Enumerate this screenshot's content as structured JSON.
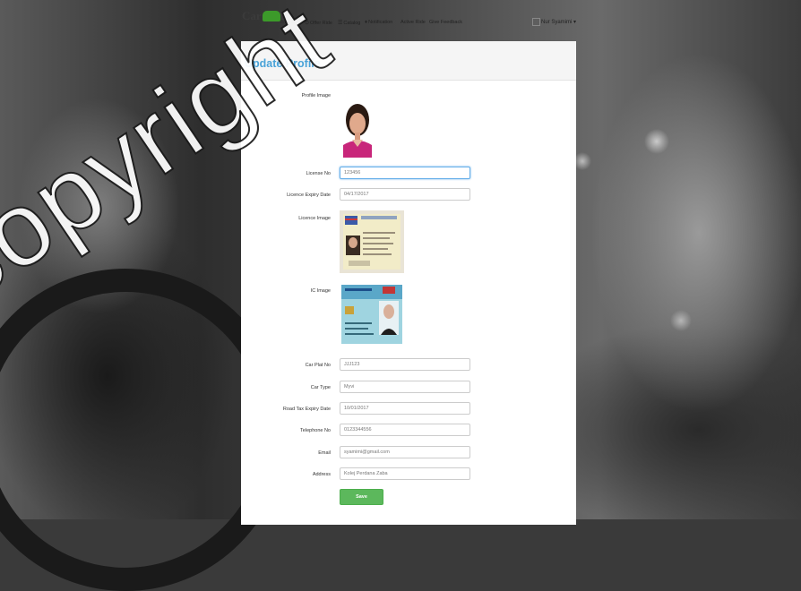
{
  "brand": {
    "logo_text": "Car Pool"
  },
  "nav": {
    "home": "Home",
    "offer_ride": "Offer Ride",
    "catalog": "Catalog",
    "notification": "Notification",
    "active_ride": "Active Ride",
    "feedback": "Give Feedback",
    "user_name": "Nur Syamimi",
    "user_caret": "▾"
  },
  "page": {
    "title": "Update Profile"
  },
  "form": {
    "profile_image_label": "Profile Image",
    "license_no_label": "License No",
    "license_no_value": "123456",
    "license_expiry_label": "Licence Expiry Date",
    "license_expiry_value": "04/17/2017",
    "license_image_label": "Licence Image",
    "ic_image_label": "IC Image",
    "car_plat_label": "Car Plat No",
    "car_plat_value": "JJJ123",
    "car_type_label": "Car Type",
    "car_type_value": "Myvi",
    "road_tax_label": "Road Tax Expiry Date",
    "road_tax_value": "10/01/2017",
    "telephone_label": "Telephone No",
    "telephone_value": "0123344556",
    "email_label": "Email",
    "email_value": "syamimi@gmail.com",
    "address_label": "Address",
    "address_value": "Kolej Perdana Zaba",
    "save_label": "Save"
  },
  "watermark": {
    "text": "copyright"
  },
  "colors": {
    "title": "#4aa3d8",
    "save_button": "#5cb85c",
    "focus_border": "#66afe9"
  }
}
